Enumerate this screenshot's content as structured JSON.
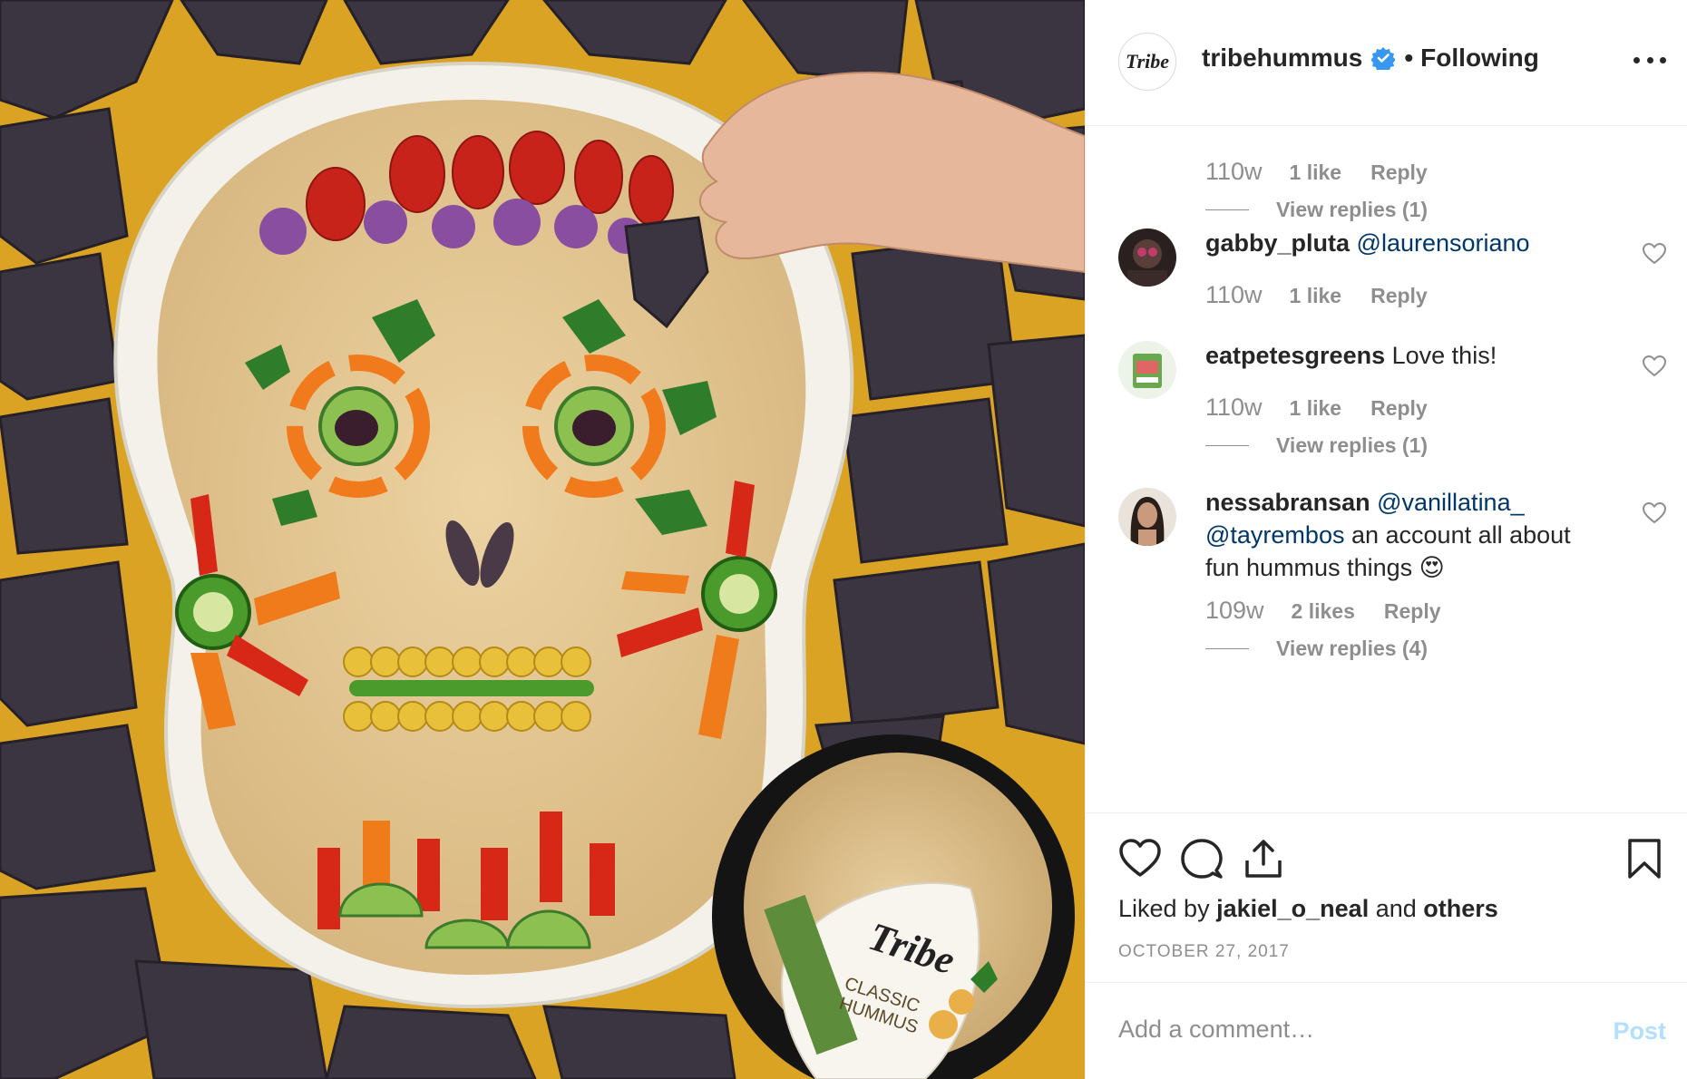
{
  "post": {
    "username": "tribehummus",
    "verified": true,
    "follow_status": "Following",
    "brand_logo_text": "Tribe",
    "image_description_icon": "hummus-skull-photo"
  },
  "comments": [
    {
      "time": "110w",
      "likes": "1 like",
      "reply": "Reply",
      "view_replies": "View replies (1)"
    },
    {
      "username": "gabby_pluta",
      "mention": "@laurensoriano",
      "text": "",
      "time": "110w",
      "likes": "1 like",
      "reply": "Reply"
    },
    {
      "username": "eatpetesgreens",
      "text": "Love this!",
      "time": "110w",
      "likes": "1 like",
      "reply": "Reply",
      "view_replies": "View replies (1)"
    },
    {
      "username": "nessabransan",
      "mention": "@vanillatina_",
      "mention2": "@tayrembos",
      "text": "an account all about",
      "text2": "fun hummus things",
      "emoji": "😍",
      "time": "109w",
      "likes": "2 likes",
      "reply": "Reply",
      "view_replies": "View replies (4)"
    }
  ],
  "actions": {
    "liked_by_prefix": "Liked by",
    "liked_by_user": "jakiel_o_neal",
    "liked_by_and": "and",
    "liked_by_others": "others",
    "date": "OCTOBER 27, 2017"
  },
  "add_comment": {
    "placeholder": "Add a comment…",
    "post_label": "Post"
  },
  "colors": {
    "link": "#00376b",
    "muted": "#8e8e8e",
    "verified": "#3897f0",
    "post_disabled": "#b2dffc"
  }
}
